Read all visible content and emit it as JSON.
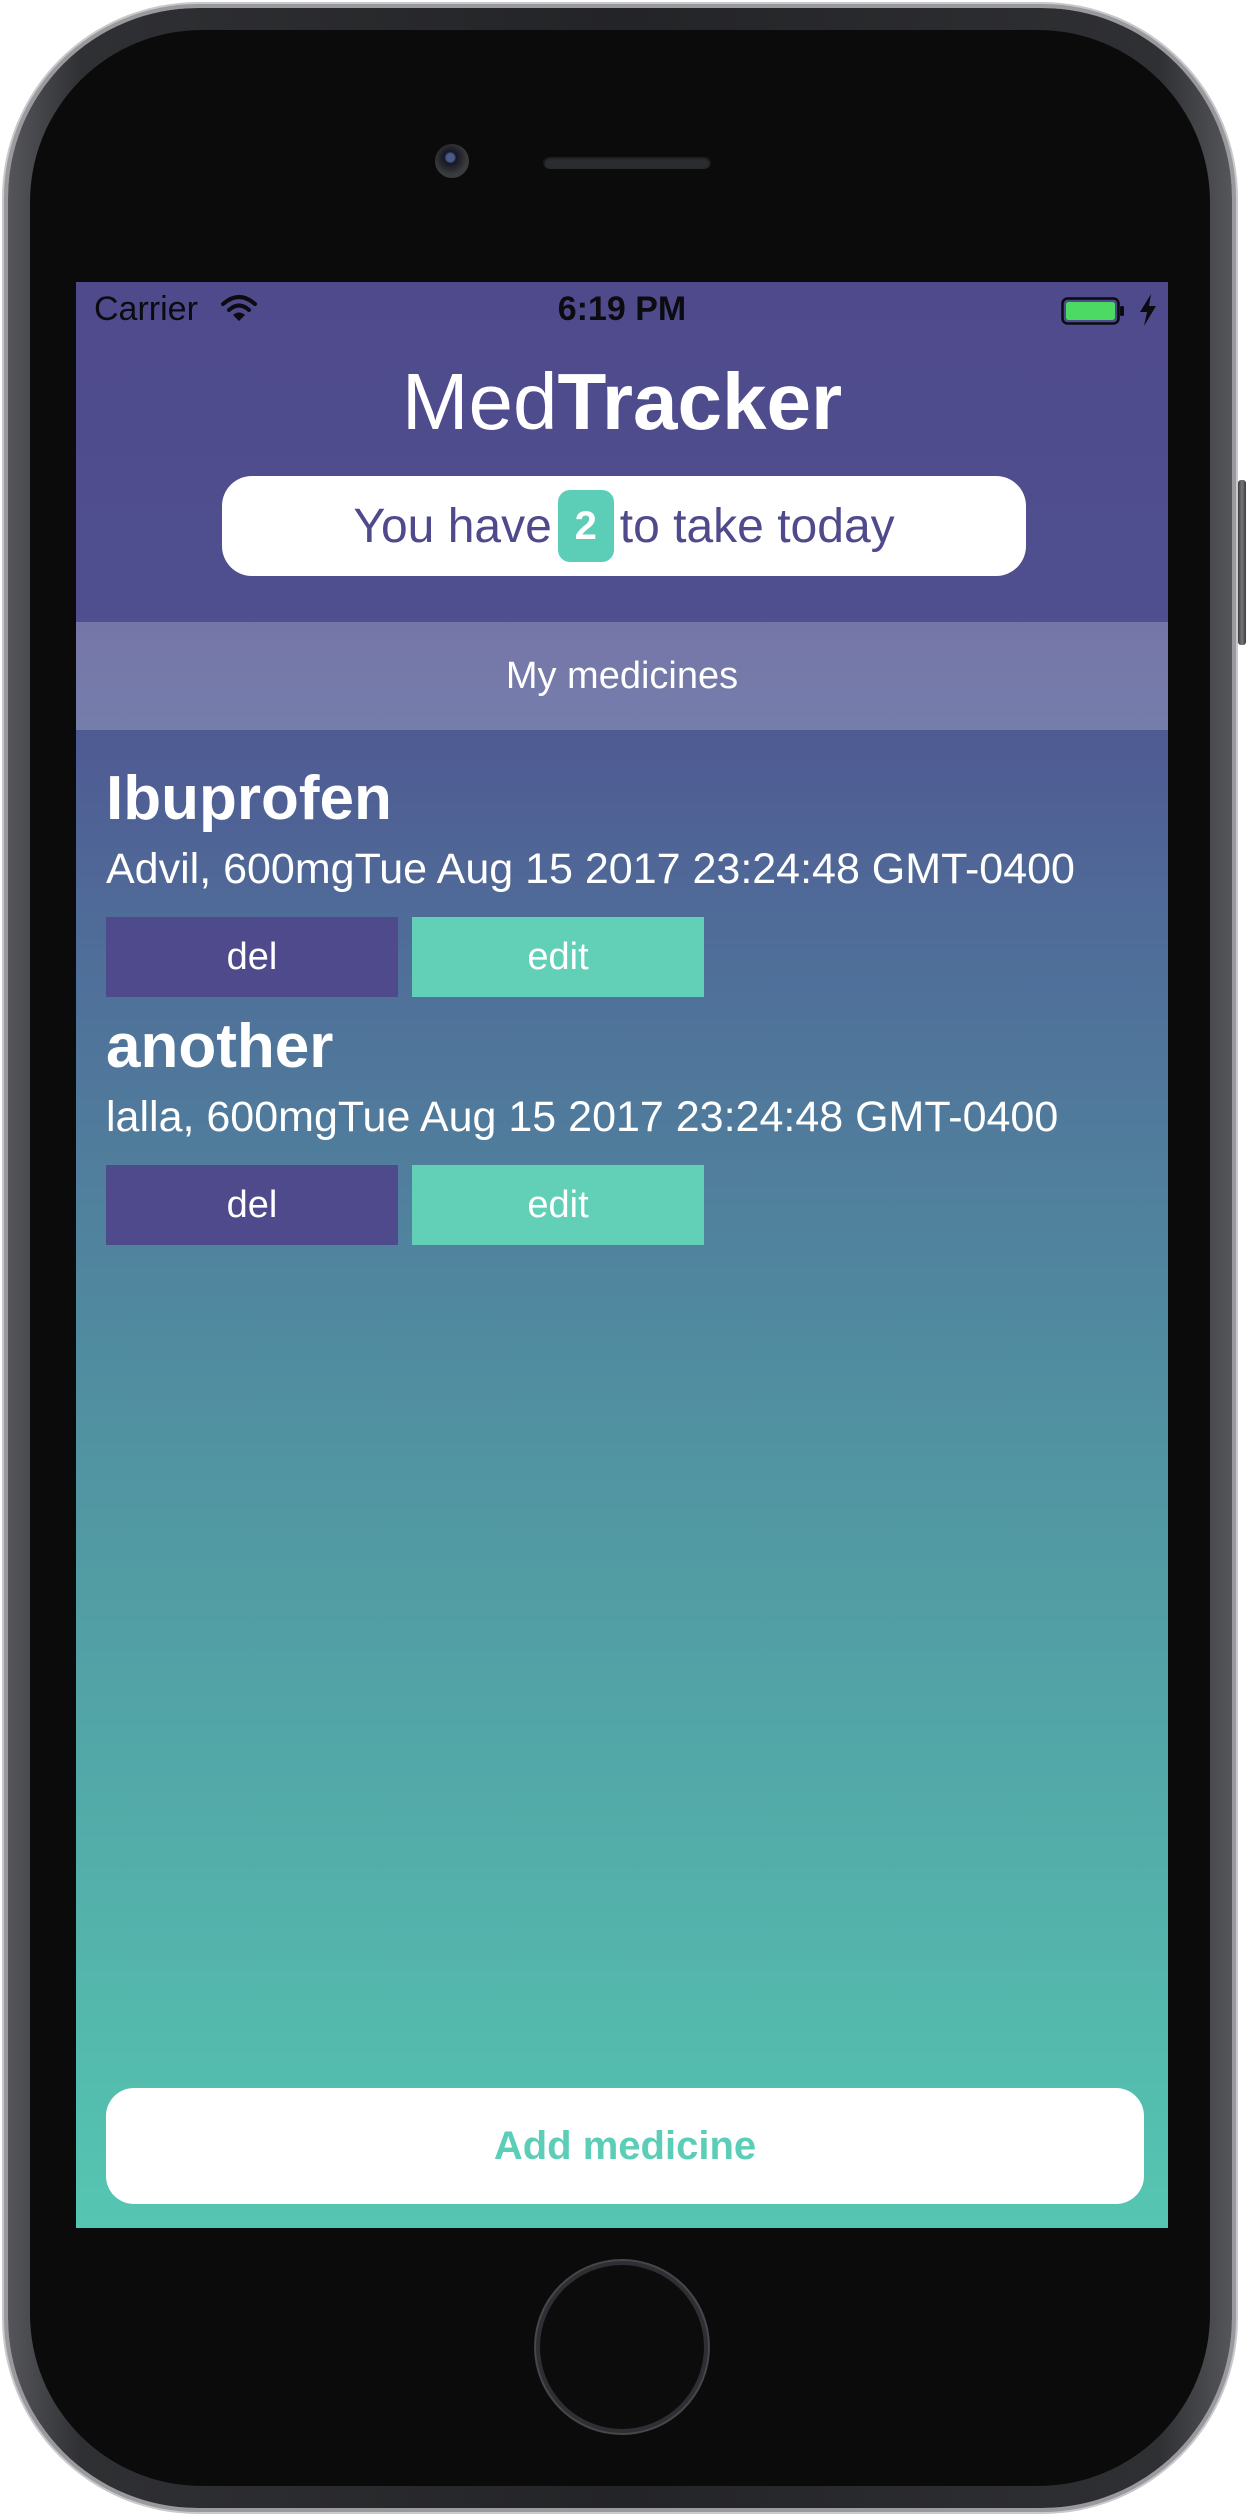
{
  "status_bar": {
    "carrier": "Carrier",
    "time": "6:19 PM"
  },
  "header": {
    "title_light": "Med",
    "title_bold": "Tracker",
    "summary_prefix": "You have",
    "summary_count": "2",
    "summary_suffix": "to take today"
  },
  "section": {
    "title": "My medicines"
  },
  "medicines": [
    {
      "name": "Ibuprofen",
      "details": "Advil, 600mgTue Aug 15 2017 23:24:48 GMT-0400",
      "delete_label": "del",
      "edit_label": "edit"
    },
    {
      "name": "another",
      "details": "lalla, 600mgTue Aug 15 2017 23:24:48 GMT-0400",
      "delete_label": "del",
      "edit_label": "edit"
    }
  ],
  "footer": {
    "add_label": "Add medicine"
  },
  "colors": {
    "primary": "#4f4a8c",
    "accent": "#5ccdb7",
    "gradient_top": "#4f4a8c",
    "gradient_bottom": "#55c6b1"
  },
  "icons": [
    "wifi-icon",
    "battery-icon",
    "charging-icon"
  ]
}
